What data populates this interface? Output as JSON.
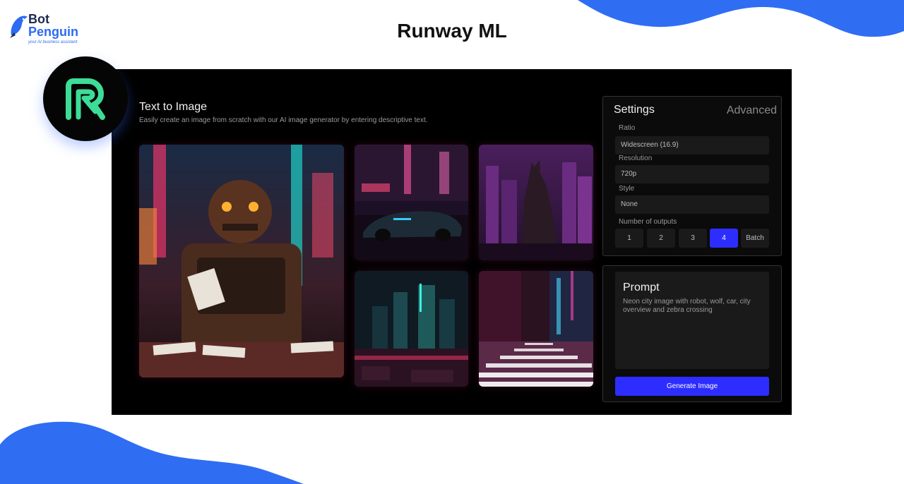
{
  "brand": {
    "name_line1": "Bot",
    "name_line2": "Penguin",
    "tagline": "your AI business assistant",
    "colors": {
      "blue": "#2c6bf2",
      "navy": "#1b2a4e"
    }
  },
  "page_title": "Runway ML",
  "app": {
    "logo_icon": "runway-logo-icon",
    "accent_color": "#2d2dff",
    "logo_color": "#3ddc97",
    "title": "Text to Image",
    "subtitle": "Easily create  an image from scratch with our AI image generator by entering descriptive text.",
    "images": [
      {
        "name": "robot-card-player-image"
      },
      {
        "name": "neon-car-image"
      },
      {
        "name": "neon-wolf-image"
      },
      {
        "name": "neon-city-overview-image"
      },
      {
        "name": "zebra-crossing-street-image"
      }
    ],
    "settings": {
      "title": "Settings",
      "advanced_tab": "Advanced",
      "ratio_label": "Ratio",
      "ratio_value": "Widescreen (16.9)",
      "resolution_label": "Resolution",
      "resolution_value": "720p",
      "style_label": "Style",
      "style_value": "None",
      "outputs_label": "Number of outputs",
      "outputs_options": [
        "1",
        "2",
        "3",
        "4",
        "Batch"
      ],
      "outputs_selected": "4"
    },
    "prompt": {
      "title": "Prompt",
      "text": "Neon city image with robot, wolf, car, city overview and zebra crossing",
      "generate_button": "Generate Image"
    }
  }
}
